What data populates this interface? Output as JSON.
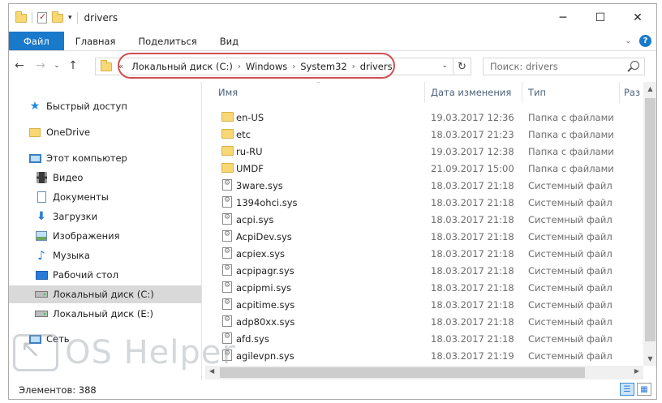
{
  "window": {
    "title": "drivers"
  },
  "controls": {
    "minimize": "─",
    "maximize": "☐",
    "close": "✕"
  },
  "ribbon": {
    "tabs": [
      "Файл",
      "Главная",
      "Поделиться",
      "Вид"
    ]
  },
  "address": {
    "breadcrumb": [
      "Локальный диск (C:)",
      "Windows",
      "System32",
      "drivers"
    ],
    "search_placeholder": "Поиск: drivers"
  },
  "sidebar": {
    "items": [
      {
        "label": "Быстрый доступ",
        "icon": "star-icon"
      },
      {
        "label": "OneDrive",
        "icon": "onedrive-icon"
      },
      {
        "label": "Этот компьютер",
        "icon": "computer-icon"
      },
      {
        "label": "Видео",
        "icon": "video-icon"
      },
      {
        "label": "Документы",
        "icon": "documents-icon"
      },
      {
        "label": "Загрузки",
        "icon": "downloads-icon"
      },
      {
        "label": "Изображения",
        "icon": "pictures-icon"
      },
      {
        "label": "Музыка",
        "icon": "music-icon"
      },
      {
        "label": "Рабочий стол",
        "icon": "desktop-icon"
      },
      {
        "label": "Локальный диск (C:)",
        "icon": "drive-icon",
        "selected": true
      },
      {
        "label": "Локальный диск (E:)",
        "icon": "drive-icon"
      },
      {
        "label": "Сеть",
        "icon": "network-icon"
      }
    ]
  },
  "columns": {
    "name": "Имя",
    "date": "Дата изменения",
    "type": "Тип",
    "size": "Раз"
  },
  "files": [
    {
      "name": "en-US",
      "date": "19.03.2017 12:36",
      "type": "Папка с файлами",
      "kind": "folder"
    },
    {
      "name": "etc",
      "date": "18.03.2017 21:23",
      "type": "Папка с файлами",
      "kind": "folder"
    },
    {
      "name": "ru-RU",
      "date": "19.03.2017 12:38",
      "type": "Папка с файлами",
      "kind": "folder"
    },
    {
      "name": "UMDF",
      "date": "21.09.2017 15:00",
      "type": "Папка с файлами",
      "kind": "folder"
    },
    {
      "name": "3ware.sys",
      "date": "18.03.2017 21:18",
      "type": "Системный файл",
      "kind": "sys"
    },
    {
      "name": "1394ohci.sys",
      "date": "18.03.2017 21:18",
      "type": "Системный файл",
      "kind": "sys"
    },
    {
      "name": "acpi.sys",
      "date": "18.03.2017 21:18",
      "type": "Системный файл",
      "kind": "sys"
    },
    {
      "name": "AcpiDev.sys",
      "date": "18.03.2017 21:18",
      "type": "Системный файл",
      "kind": "sys"
    },
    {
      "name": "acpiex.sys",
      "date": "18.03.2017 21:18",
      "type": "Системный файл",
      "kind": "sys"
    },
    {
      "name": "acpipagr.sys",
      "date": "18.03.2017 21:18",
      "type": "Системный файл",
      "kind": "sys"
    },
    {
      "name": "acpipmi.sys",
      "date": "18.03.2017 21:18",
      "type": "Системный файл",
      "kind": "sys"
    },
    {
      "name": "acpitime.sys",
      "date": "18.03.2017 21:18",
      "type": "Системный файл",
      "kind": "sys"
    },
    {
      "name": "adp80xx.sys",
      "date": "18.03.2017 21:18",
      "type": "Системный файл",
      "kind": "sys"
    },
    {
      "name": "afd.sys",
      "date": "18.03.2017 21:18",
      "type": "Системный файл",
      "kind": "sys"
    },
    {
      "name": "agilevpn.sys",
      "date": "18.03.2017 21:19",
      "type": "Системный файл",
      "kind": "sys"
    }
  ],
  "status": {
    "items_count": "Элементов: 388"
  },
  "watermark": {
    "text": "OS Helper"
  },
  "colors": {
    "accent": "#1979ca",
    "highlight_ring": "#d05050"
  }
}
